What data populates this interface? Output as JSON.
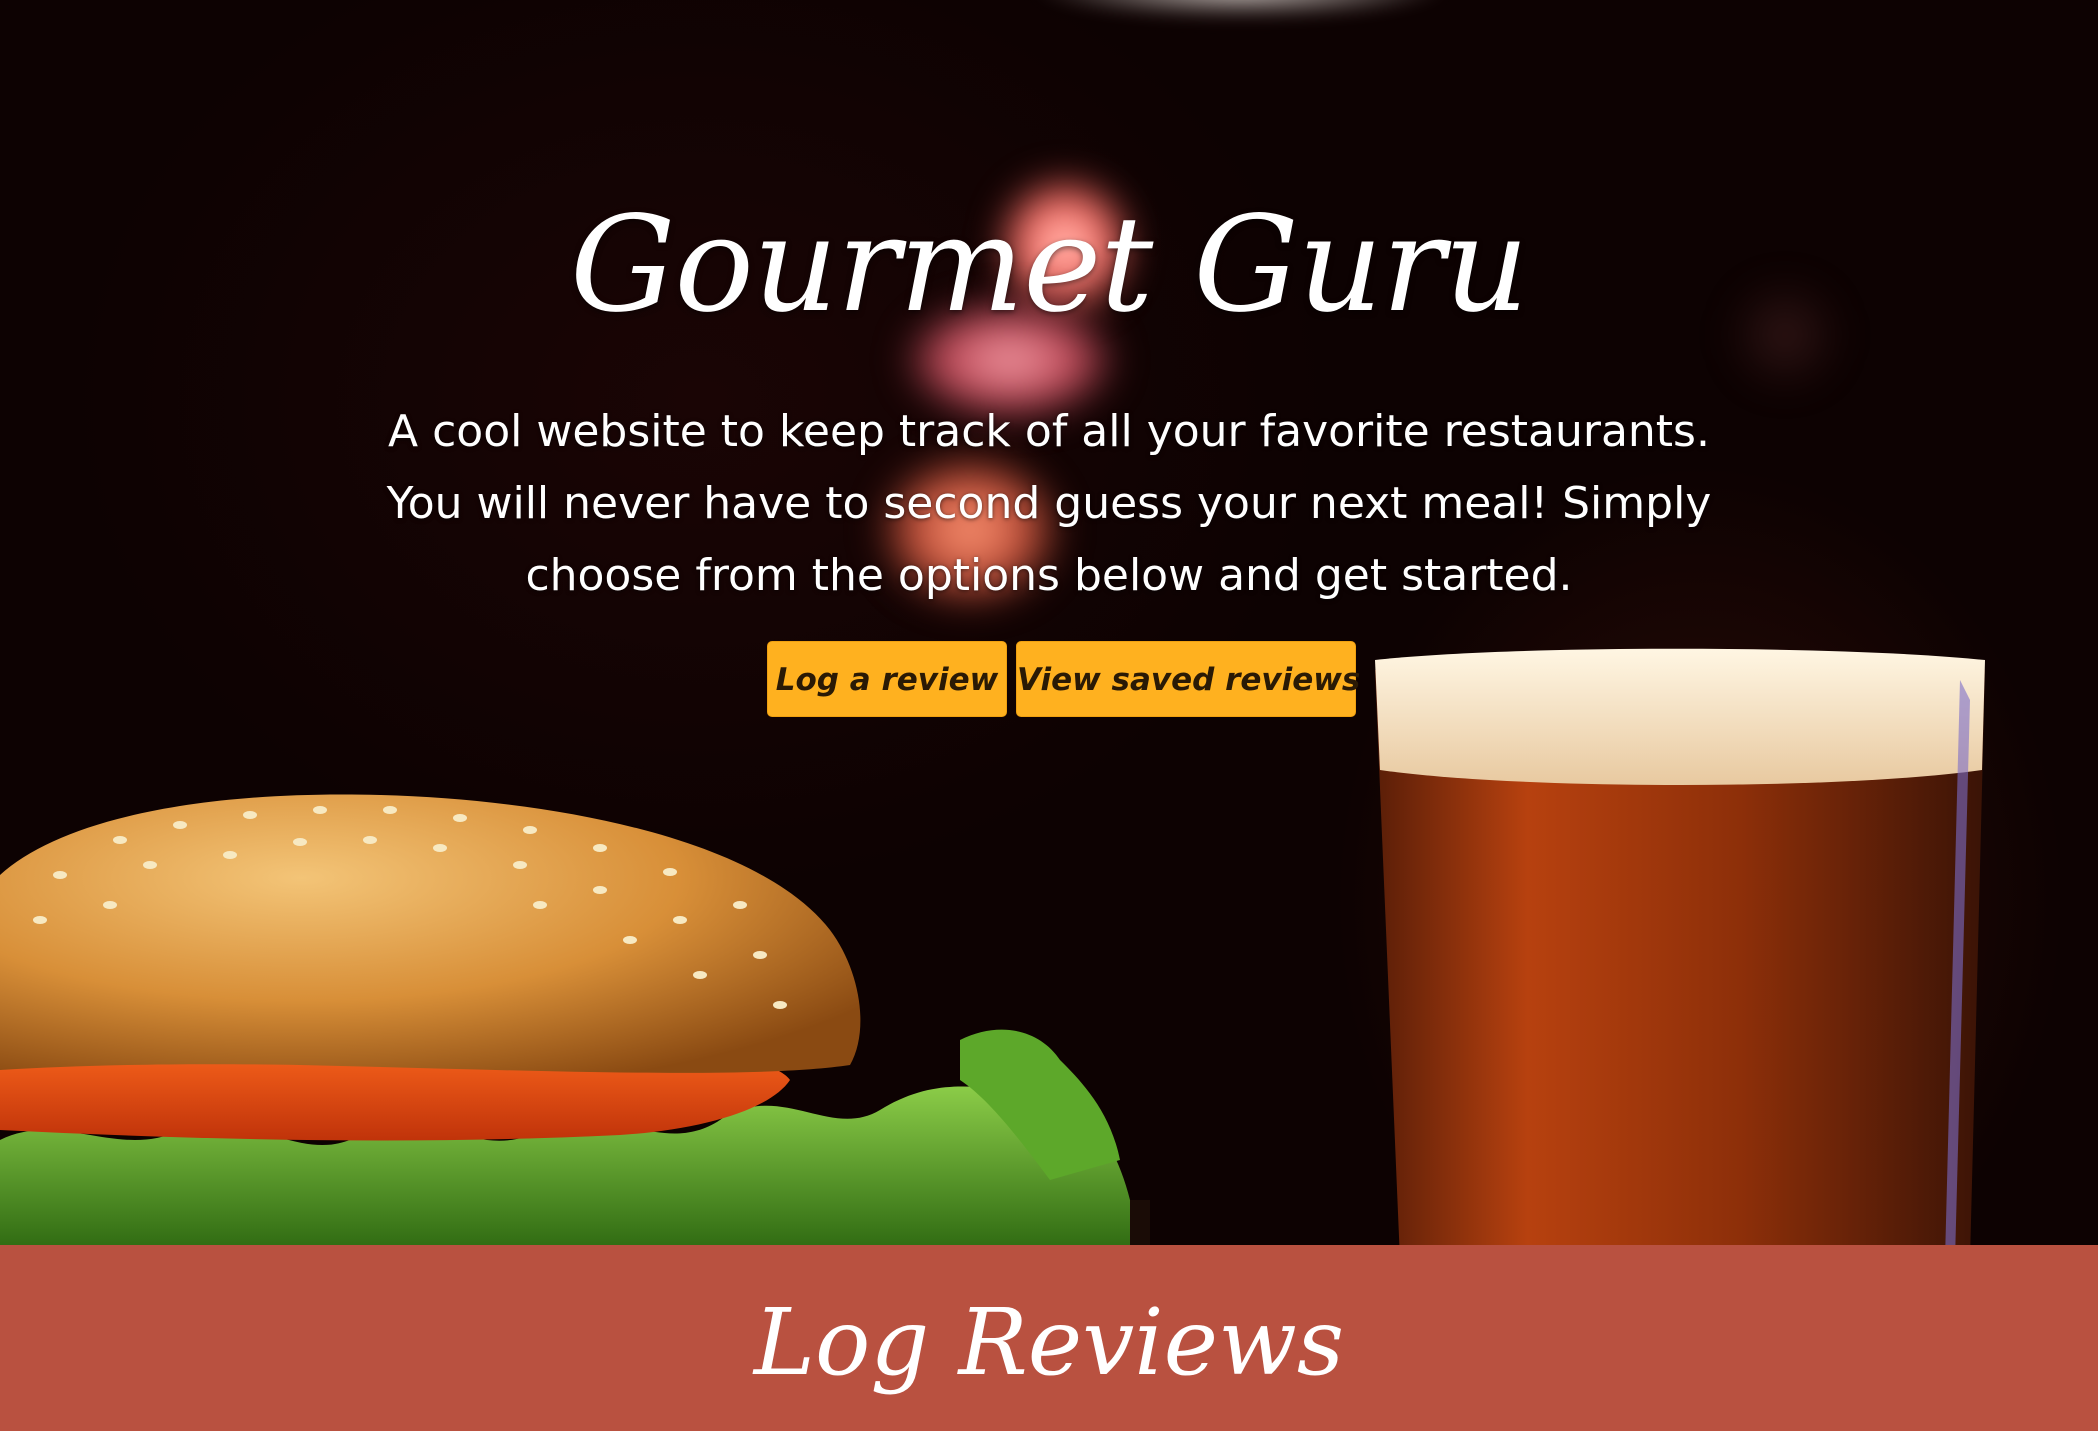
{
  "hero": {
    "title": "Gourmet Guru",
    "description": "A cool website to keep track of all your favorite restaurants. You will never have to second guess your next meal! Simply choose from the options below and get started.",
    "buttons": {
      "log_review": "Log a review",
      "view_saved": "View saved reviews"
    },
    "button_color": "#ffb11f"
  },
  "section": {
    "title": "Log Reviews",
    "background_color": "#b95140"
  }
}
